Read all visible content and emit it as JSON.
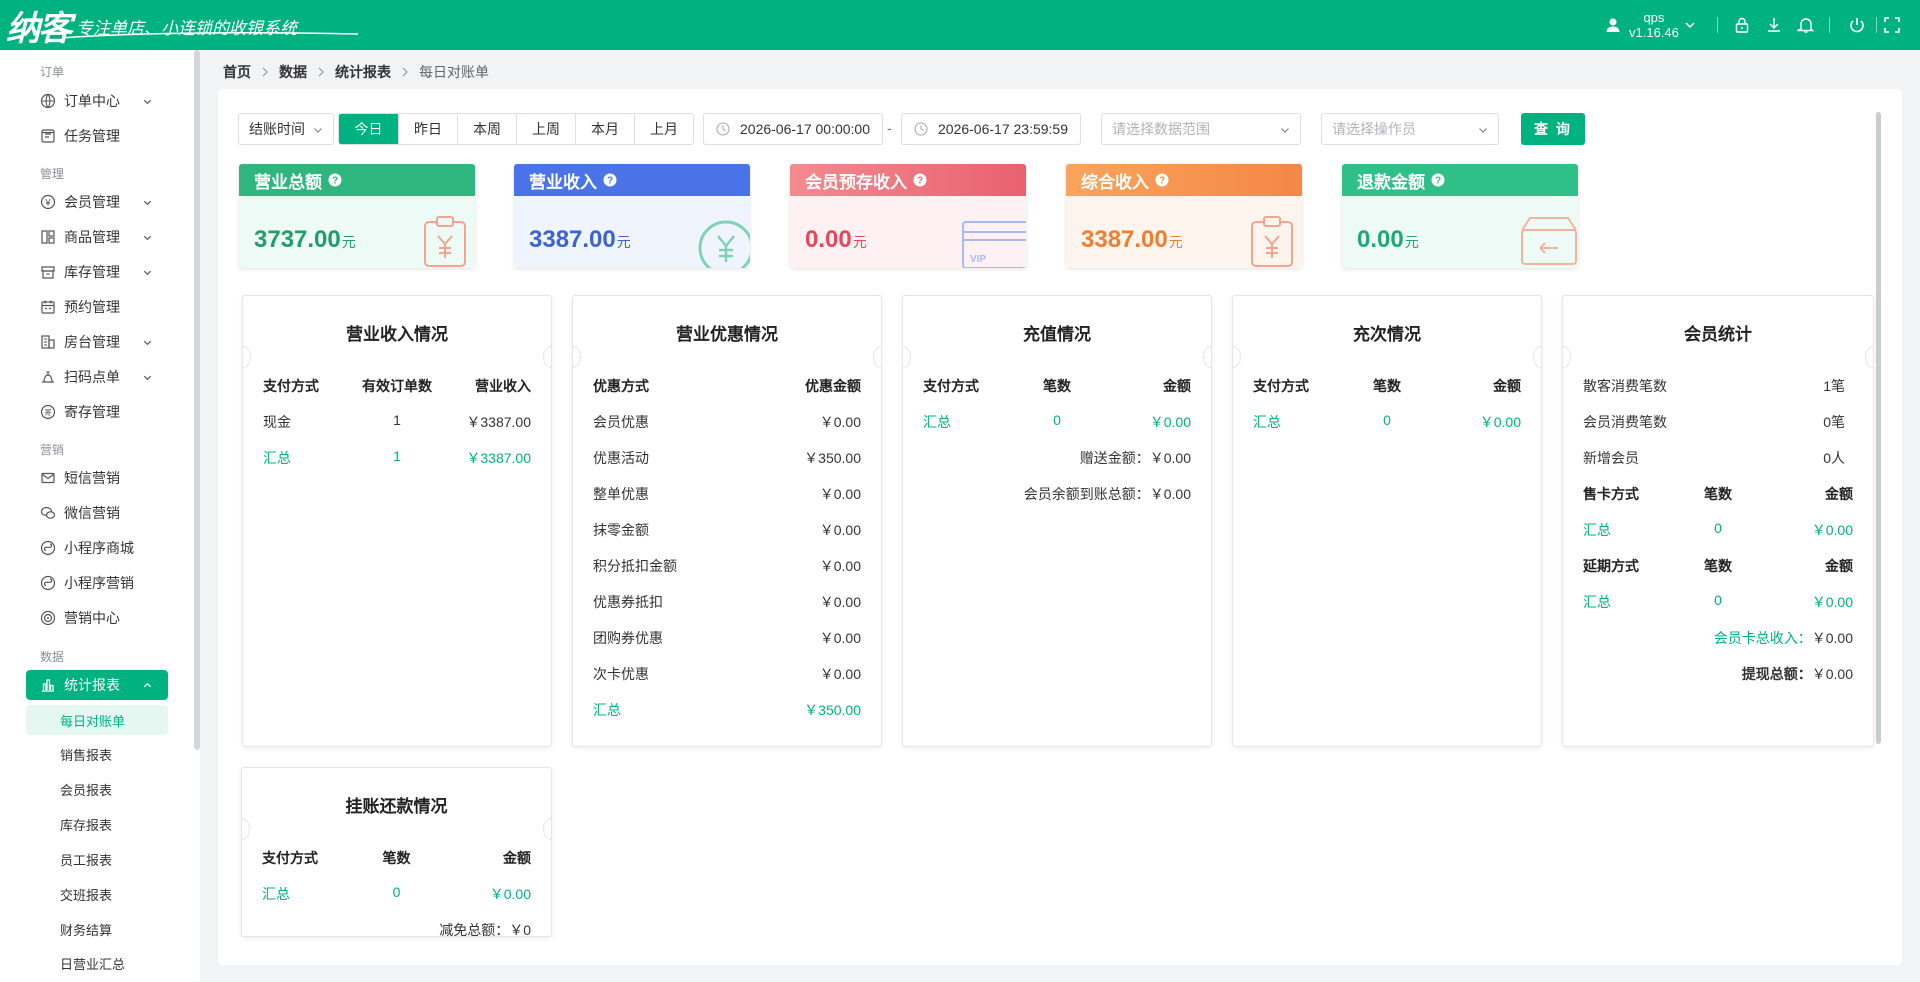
{
  "app": {
    "logo_text": "纳客",
    "slogan": "专注单店、小连锁的收银系统",
    "username": "qps",
    "version": "v1.16.46",
    "accent_color": "#00b27f"
  },
  "topbar_icons": [
    "user-icon",
    "lock-icon",
    "download-icon",
    "bell-icon",
    "power-icon",
    "fullscreen-icon"
  ],
  "sidebar": {
    "groups": [
      {
        "label": "订单",
        "items": [
          {
            "label": "订单中心",
            "icon": "globe-icon",
            "expandable": true
          },
          {
            "label": "任务管理",
            "icon": "task-icon",
            "expandable": false
          }
        ]
      },
      {
        "label": "管理",
        "items": [
          {
            "label": "会员管理",
            "icon": "member-icon",
            "expandable": true
          },
          {
            "label": "商品管理",
            "icon": "goods-icon",
            "expandable": true
          },
          {
            "label": "库存管理",
            "icon": "inventory-icon",
            "expandable": true
          },
          {
            "label": "预约管理",
            "icon": "calendar-icon",
            "expandable": false
          },
          {
            "label": "房台管理",
            "icon": "building-icon",
            "expandable": true
          },
          {
            "label": "扫码点单",
            "icon": "scan-icon",
            "expandable": true
          },
          {
            "label": "寄存管理",
            "icon": "deposit-icon",
            "expandable": false
          }
        ]
      },
      {
        "label": "营销",
        "items": [
          {
            "label": "短信营销",
            "icon": "mail-icon",
            "expandable": false
          },
          {
            "label": "微信营销",
            "icon": "wechat-icon",
            "expandable": false
          },
          {
            "label": "小程序商城",
            "icon": "miniapp-icon",
            "expandable": false
          },
          {
            "label": "小程序营销",
            "icon": "miniapp-icon",
            "expandable": false
          },
          {
            "label": "营销中心",
            "icon": "target-icon",
            "expandable": false
          }
        ]
      },
      {
        "label": "数据",
        "items": [
          {
            "label": "统计报表",
            "icon": "chart-icon",
            "expandable": true,
            "active": true
          }
        ]
      }
    ],
    "sub_items": [
      "每日对账单",
      "销售报表",
      "会员报表",
      "库存报表",
      "员工报表",
      "交班报表",
      "财务结算",
      "日营业汇总"
    ],
    "active_sub": "每日对账单"
  },
  "breadcrumb": [
    "首页",
    "数据",
    "统计报表",
    "每日对账单"
  ],
  "filters": {
    "time_type": "结账时间",
    "period_buttons": [
      "今日",
      "昨日",
      "本周",
      "上周",
      "本月",
      "上月"
    ],
    "active_period": "今日",
    "start_time": "2026-06-17 00:00:00",
    "date_sep": "-",
    "end_time": "2026-06-17 23:59:59",
    "data_range_placeholder": "请选择数据范围",
    "operator_placeholder": "请选择操作员",
    "query_label": "查 询"
  },
  "stats": [
    {
      "title": "营业总额",
      "value": "3737.00",
      "unit": "元",
      "color": "#2fb57e",
      "value_color": "#1e9e68",
      "bg": "#eefaf5"
    },
    {
      "title": "营业收入",
      "value": "3387.00",
      "unit": "元",
      "color": "#4a73e8",
      "value_color": "#3b63d6",
      "bg": "#f0f4fd"
    },
    {
      "title": "会员预存收入",
      "value": "0.00",
      "unit": "元",
      "color": "#ef6b7a",
      "value_color": "#e5485c",
      "bg": "#fdf1f3"
    },
    {
      "title": "综合收入",
      "value": "3387.00",
      "unit": "元",
      "color": "#f7924f",
      "value_color": "#f07e30",
      "bg": "#fef4ee"
    },
    {
      "title": "退款金额",
      "value": "0.00",
      "unit": "元",
      "color": "#2fbf89",
      "value_color": "#1fa874",
      "bg": "#eefaf5"
    }
  ],
  "revenue": {
    "title": "营业收入情况",
    "headers": [
      "支付方式",
      "有效订单数",
      "营业收入"
    ],
    "rows": [
      {
        "method": "现金",
        "count": "1",
        "amount": "￥3387.00"
      }
    ],
    "total": {
      "method": "汇总",
      "count": "1",
      "amount": "￥3387.00"
    }
  },
  "discount": {
    "title": "营业优惠情况",
    "headers": [
      "优惠方式",
      "优惠金额"
    ],
    "rows": [
      {
        "method": "会员优惠",
        "amount": "￥0.00"
      },
      {
        "method": "优惠活动",
        "amount": "￥350.00"
      },
      {
        "method": "整单优惠",
        "amount": "￥0.00"
      },
      {
        "method": "抹零金额",
        "amount": "￥0.00"
      },
      {
        "method": "积分抵扣金额",
        "amount": "￥0.00"
      },
      {
        "method": "优惠券抵扣",
        "amount": "￥0.00"
      },
      {
        "method": "团购券优惠",
        "amount": "￥0.00"
      },
      {
        "method": "次卡优惠",
        "amount": "￥0.00"
      }
    ],
    "total": {
      "method": "汇总",
      "amount": "￥350.00"
    }
  },
  "recharge": {
    "title": "充值情况",
    "headers": [
      "支付方式",
      "笔数",
      "金额"
    ],
    "total": {
      "method": "汇总",
      "count": "0",
      "amount": "￥0.00"
    },
    "notes": [
      {
        "label": "赠送金额：",
        "value": "￥0.00"
      },
      {
        "label": "会员余额到账总额：",
        "value": "￥0.00"
      }
    ]
  },
  "times_recharge": {
    "title": "充次情况",
    "headers": [
      "支付方式",
      "笔数",
      "金额"
    ],
    "total": {
      "method": "汇总",
      "count": "0",
      "amount": "￥0.00"
    }
  },
  "member": {
    "title": "会员统计",
    "stats": [
      {
        "label": "散客消费笔数",
        "value": "1笔"
      },
      {
        "label": "会员消费笔数",
        "value": "0笔"
      },
      {
        "label": "新增会员",
        "value": "0人"
      }
    ],
    "card_sale": {
      "headers": [
        "售卡方式",
        "笔数",
        "金额"
      ],
      "total": {
        "method": "汇总",
        "count": "0",
        "amount": "￥0.00"
      }
    },
    "extend": {
      "headers": [
        "延期方式",
        "笔数",
        "金额"
      ],
      "total": {
        "method": "汇总",
        "count": "0",
        "amount": "￥0.00"
      }
    },
    "card_income": {
      "label": "会员卡总收入：",
      "value": "￥0.00"
    },
    "withdraw": {
      "label": "提现总额：",
      "value": "￥0.00"
    }
  },
  "credit": {
    "title": "挂账还款情况",
    "headers": [
      "支付方式",
      "笔数",
      "金额"
    ],
    "total": {
      "method": "汇总",
      "count": "0",
      "amount": "￥0.00"
    },
    "waive": {
      "label": "减免总额：",
      "value": "￥0"
    }
  }
}
